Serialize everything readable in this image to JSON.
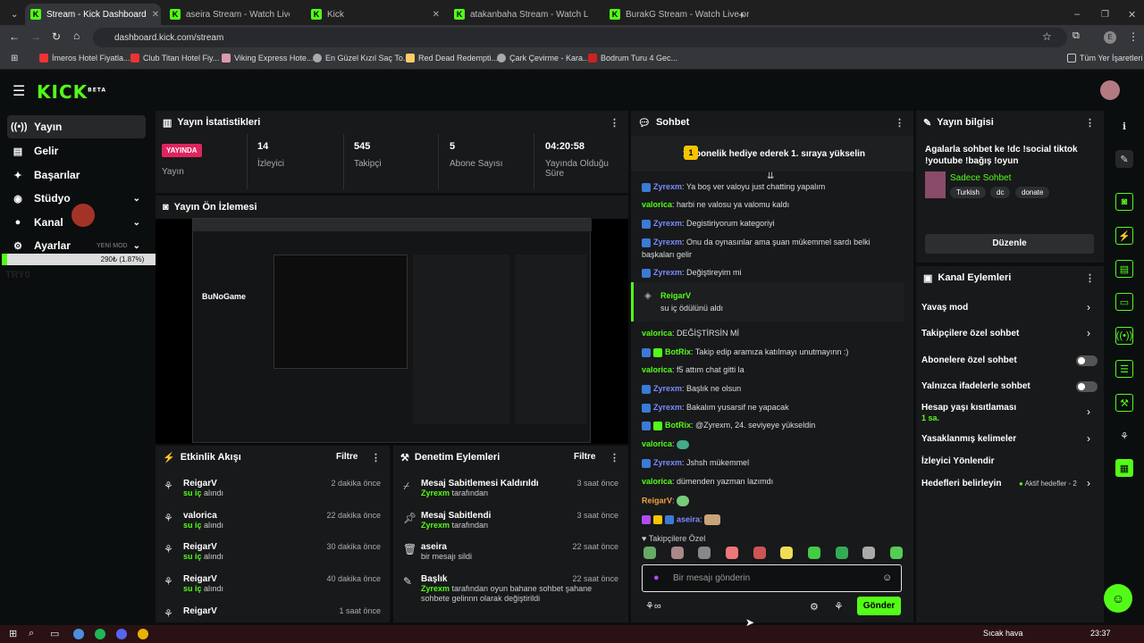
{
  "browser": {
    "tabs": [
      {
        "label": "Stream - Kick Dashboard",
        "active": true
      },
      {
        "label": "aseira Stream - Watch Live on K"
      },
      {
        "label": "Kick"
      },
      {
        "label": "atakanbaha Stream - Watch Liv"
      },
      {
        "label": "BurakG Stream - Watch Live on"
      }
    ],
    "url": "dashboard.kick.com/stream",
    "bookmarks": [
      "İmeros Hotel Fiyatla...",
      "Club Titan Hotel Fiy...",
      "Viking Express Hote...",
      "En Güzel Kızıl Saç To...",
      "Red Dead Redempti...",
      "Çark Çevirme - Kara...",
      "Bodrum Turu 4 Gec..."
    ],
    "all_bookmarks": "Tüm Yer İşaretleri"
  },
  "brand": {
    "logo": "KICK",
    "beta": "BETA"
  },
  "sidebar": {
    "items": [
      {
        "label": "Yayın",
        "active": true
      },
      {
        "label": "Gelir"
      },
      {
        "label": "Başarılar"
      },
      {
        "label": "Stüdyo"
      },
      {
        "label": "Kanal"
      },
      {
        "label": "Ayarlar"
      }
    ],
    "overlay_bar": "290₺ (1.87%)",
    "overlay_text": "YENİ MOD",
    "overlay_sub": "TRY0"
  },
  "stats": {
    "title": "Yayın İstatistikleri",
    "live_badge": "YAYINDA",
    "live_label": "Yayın",
    "items": [
      {
        "value": "14",
        "label": "İzleyici"
      },
      {
        "value": "545",
        "label": "Takipçi"
      },
      {
        "value": "5",
        "label": "Abone Sayısı"
      },
      {
        "value": "04:20:58",
        "label": "Yayında Olduğu Süre"
      }
    ]
  },
  "preview": {
    "title": "Yayın Ön İzlemesi",
    "watermark": "BuNoGame"
  },
  "activity": {
    "title": "Etkinlik Akışı",
    "filter": "Filtre",
    "items": [
      {
        "user": "ReigarV",
        "action": "su iç",
        "suffix": " alındı",
        "time": "2 dakika önce"
      },
      {
        "user": "valorica",
        "action": "su iç",
        "suffix": " alındı",
        "time": "22 dakika önce"
      },
      {
        "user": "ReigarV",
        "action": "su iç",
        "suffix": " alındı",
        "time": "30 dakika önce"
      },
      {
        "user": "ReigarV",
        "action": "su iç",
        "suffix": " alındı",
        "time": "40 dakika önce"
      },
      {
        "user": "ReigarV",
        "action": "",
        "suffix": "",
        "time": "1 saat önce"
      }
    ]
  },
  "moderation": {
    "title": "Denetim Eylemleri",
    "filter": "Filtre",
    "items": [
      {
        "title": "Mesaj Sabitlemesi Kaldırıldı",
        "user": "Zyrexm",
        "rest": " tarafından",
        "time": "3 saat önce"
      },
      {
        "title": "Mesaj Sabitlendi",
        "user": "Zyrexm",
        "rest": " tarafından",
        "time": "3 saat önce"
      },
      {
        "title": "aseira",
        "user": "",
        "rest": "bir mesajı sildi",
        "time": "22 saat önce"
      },
      {
        "title": "Başlık",
        "user": "Zyrexm",
        "rest": " tarafından oyun bahane sohbet şahane sohbete gelinnn olarak değiştirildi",
        "time": "22 saat önce"
      }
    ]
  },
  "chat": {
    "title": "Sohbet",
    "pinned": "1 abonelik hediye ederek 1. sıraya yükselin",
    "pinned_num": "1",
    "messages": [
      {
        "user": "Zyrexm",
        "text": "Ya boş ver valoyu just chatting yapalım",
        "color": "#7b8cff",
        "badge": true
      },
      {
        "user": "valorica",
        "text": "harbi ne valosu ya valomu kaldı",
        "color": "#53fc18"
      },
      {
        "user": "Zyrexm",
        "text": "Degistiriyorum kategoriyi",
        "color": "#7b8cff",
        "badge": true
      },
      {
        "user": "Zyrexm",
        "text": "Onu da oynasınlar ama şuan mükemmel sardı belki",
        "color": "#7b8cff",
        "badge": true
      },
      {
        "user": "",
        "text": "başkaları gelir",
        "color": ""
      },
      {
        "user": "Zyrexm",
        "text": "Değiştireyim mi",
        "color": "#7b8cff",
        "badge": true
      },
      {
        "user": "valorica",
        "text": "DEĞİŞTİRSİN Mİ",
        "color": "#53fc18"
      },
      {
        "user": "BotRix",
        "text": "Takip edip aramıza katılmayı unutmayınn :)",
        "color": "#53fc18",
        "badge": true
      },
      {
        "user": "valorica",
        "text": "f5 attım chat gitti la",
        "color": "#53fc18"
      },
      {
        "user": "Zyrexm",
        "text": "Başlık ne olsun",
        "color": "#7b8cff",
        "badge": true
      },
      {
        "user": "Zyrexm",
        "text": "Bakalım yusarsif ne yapacak",
        "color": "#7b8cff",
        "badge": true
      },
      {
        "user": "BotRix",
        "text": "@Zyrexm, 24. seviyeye yükseldin",
        "color": "#53fc18",
        "badge": true
      },
      {
        "user": "valorica",
        "text": "",
        "color": "#53fc18"
      },
      {
        "user": "Zyrexm",
        "text": "Jshsh mükemmel",
        "color": "#7b8cff",
        "badge": true
      },
      {
        "user": "valorica",
        "text": "dümenden yazman lazımdı",
        "color": "#53fc18"
      },
      {
        "user": "ReigarV",
        "text": "",
        "color": "#f0a040"
      },
      {
        "user": "aseira",
        "text": "",
        "color": "#7b8cff"
      }
    ],
    "redeem": {
      "user": "ReigarV",
      "text": "su iç ödülünü aldı"
    },
    "followers_only": "Takipçilere Özel",
    "input_placeholder": "Bir mesajı gönderin",
    "send": "Gönder"
  },
  "info": {
    "title": "Yayın bilgisi",
    "stream_title": "Agalarla sohbet ke !dc !social tiktok !youtube !bağış !oyun",
    "category": "Sadece Sohbet",
    "tags": [
      "Turkish",
      "dc",
      "donate"
    ],
    "edit": "Düzenle"
  },
  "channel_actions": {
    "title": "Kanal Eylemleri",
    "items": [
      {
        "label": "Yavaş mod",
        "type": "arrow"
      },
      {
        "label": "Takipçilere özel sohbet",
        "type": "arrow"
      },
      {
        "label": "Abonelere özel sohbet",
        "type": "toggle"
      },
      {
        "label": "Yalnızca ifadelerle sohbet",
        "type": "toggle"
      },
      {
        "label": "Hesap yaşı kısıtlaması",
        "sub": "1 sa.",
        "type": "arrow"
      },
      {
        "label": "Yasaklanmış kelimeler",
        "type": "arrow"
      },
      {
        "label": "İzleyici Yönlendir",
        "type": "none"
      },
      {
        "label": "Hedefleri belirleyin",
        "note": "Aktif hedefler - 2",
        "type": "arrow"
      }
    ]
  },
  "taskbar": {
    "weather": "Sıcak hava",
    "time": "23:37"
  },
  "colors": {
    "accent": "#53fc18",
    "live": "#e0245e"
  }
}
